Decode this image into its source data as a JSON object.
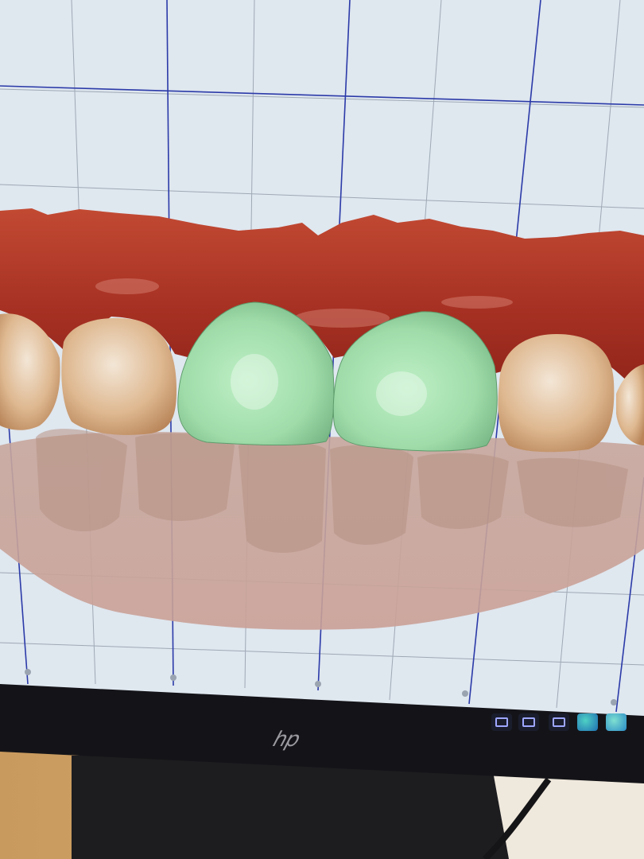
{
  "viewport": {
    "background": "#dfe7ef",
    "grid_minor_color": "#8f9aa7",
    "grid_major_color": "#2b3aa8"
  },
  "model": {
    "gingiva_color": "#a83224",
    "natural_tooth_color": "#e2c29e",
    "design_crown_color": "#9fdcaa"
  },
  "taskbar": {
    "icons": [
      "app-window-icon",
      "app-window-icon",
      "app-window-icon",
      "edge-browser-icon",
      "edge-browser-icon"
    ]
  },
  "monitor": {
    "brand_logo": "hp"
  }
}
